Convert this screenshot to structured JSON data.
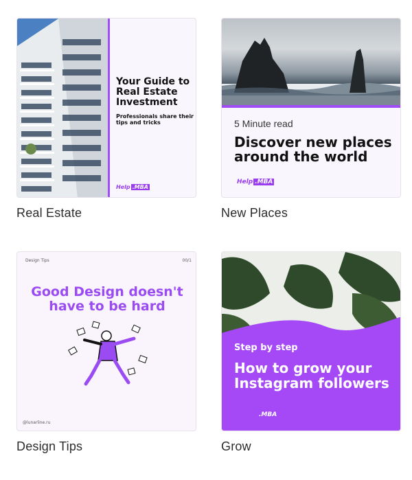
{
  "cards": [
    {
      "caption": "Real Estate",
      "title": "Your Guide to Real Estate Investment",
      "subtitle": "Professionals share their tips and tricks",
      "logo_prefix": "Help",
      "logo_suffix": ".MBA"
    },
    {
      "caption": "New Places",
      "kicker": "5 Minute read",
      "title": "Discover new places around the world",
      "logo_prefix": "Help",
      "logo_suffix": ".MBA"
    },
    {
      "caption": "Design Tips",
      "top_left": "Design Tips",
      "top_right": "00/1",
      "title": "Good Design doesn't have to be hard",
      "handle": "@lunarline.ru"
    },
    {
      "caption": "Grow",
      "kicker": "Step by step",
      "title": "How to grow your Instagram followers",
      "logo": ".MBA"
    }
  ],
  "colors": {
    "accent": "#a04cf7",
    "card_bg": "#faf6fd",
    "caption": "#2b2b2b"
  }
}
